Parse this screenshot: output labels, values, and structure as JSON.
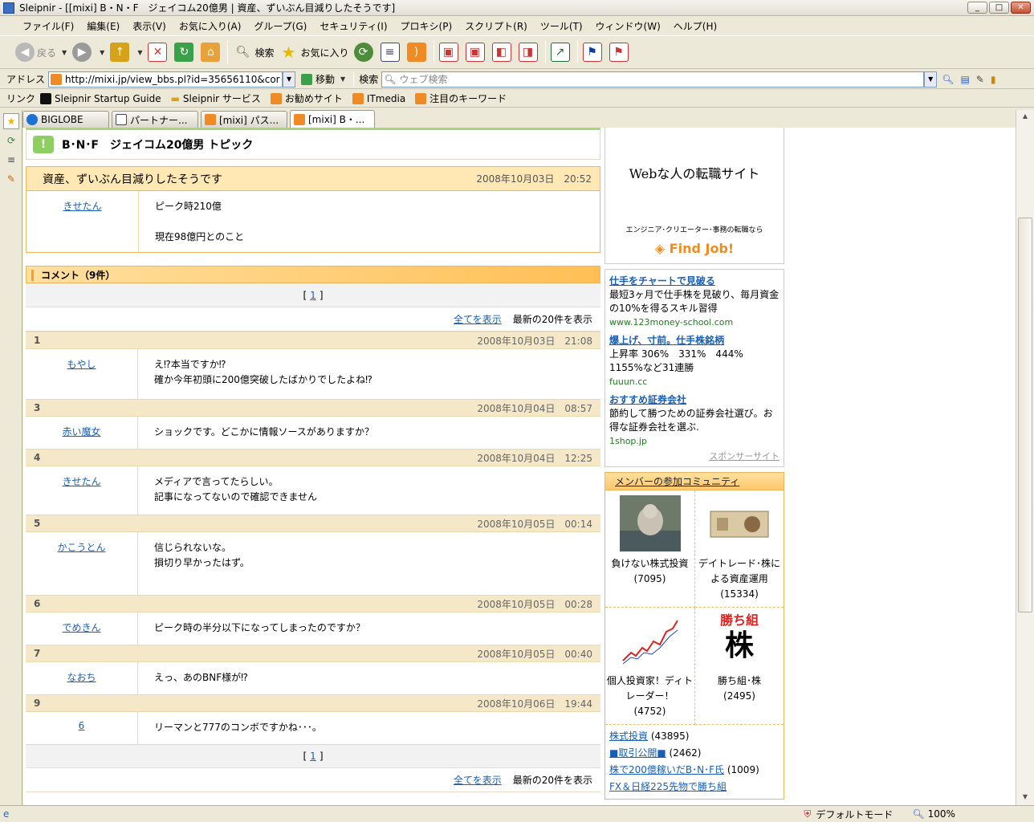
{
  "window": {
    "title": "Sleipnir - [[mixi] B・N・F　ジェイコム20億男 | 資産、ずいぶん目減りしたそうです]"
  },
  "menu": [
    "ファイル(F)",
    "編集(E)",
    "表示(V)",
    "お気に入り(A)",
    "グループ(G)",
    "セキュリティ(I)",
    "プロキシ(P)",
    "スクリプト(R)",
    "ツール(T)",
    "ウィンドウ(W)",
    "ヘルプ(H)"
  ],
  "toolbar": {
    "back": "戻る",
    "search": "検索",
    "favorites": "お気に入り"
  },
  "address": {
    "label": "アドレス",
    "url": "http://mixi.jp/view_bbs.pl?id=35656110&cor",
    "go": "移動",
    "search_label": "検索",
    "search_placeholder": "ウェブ検索"
  },
  "links": {
    "label": "リンク",
    "items": [
      "Sleipnir Startup Guide",
      "Sleipnir サービス",
      "お勧めサイト",
      "ITmedia",
      "注目のキーワード"
    ]
  },
  "tabs": [
    "BIGLOBE",
    "パートナー...",
    "[mixi] パス...",
    "[mixi] B・..."
  ],
  "topic": {
    "title": "B･N･F　ジェイコム20億男 トピック"
  },
  "post": {
    "title": "資産、ずいぶん目減りしたそうです",
    "date": "2008年10月03日　20:52",
    "author": "きせたん",
    "line1": "ピーク時210億",
    "line2": "現在98億円とのこと"
  },
  "comments_header": "コメント（9件）",
  "pager": {
    "page": "1",
    "show_all": "全てを表示",
    "latest": "最新の20件を表示"
  },
  "comments": [
    {
      "num": "1",
      "date": "2008年10月03日　21:08",
      "author": "もやし",
      "lines": [
        "え⁉本当ですか⁉",
        "確か今年初頭に200億突破したばかりでしたよね⁉"
      ]
    },
    {
      "num": "3",
      "date": "2008年10月04日　08:57",
      "author": "赤い魔女",
      "lines": [
        "ショックです。どこかに情報ソースがありますか？"
      ]
    },
    {
      "num": "4",
      "date": "2008年10月04日　12:25",
      "author": "きせたん",
      "lines": [
        "メディアで言ってたらしい。",
        "記事になってないので確認できません"
      ]
    },
    {
      "num": "5",
      "date": "2008年10月05日　00:14",
      "author": "かこうとん",
      "lines": [
        "信じられないな。",
        "損切り早かったはず。"
      ]
    },
    {
      "num": "6",
      "date": "2008年10月05日　00:28",
      "author": "でめきん",
      "lines": [
        "ピーク時の半分以下になってしまったのですか？"
      ]
    },
    {
      "num": "7",
      "date": "2008年10月05日　00:40",
      "author": "なおち",
      "lines": [
        "えっ、あのBNF様が⁉"
      ]
    },
    {
      "num": "9",
      "date": "2008年10月06日　19:44",
      "author": "6",
      "lines": [
        "リーマンと777のコンボですかね･･･。"
      ]
    }
  ],
  "ad_top": {
    "headline": "Webな人の転職サイト",
    "sub": "エンジニア･クリエーター･事務の転職なら",
    "brand": "Find Job!"
  },
  "sponsored": [
    {
      "title": "仕手をチャートで見破る",
      "desc": "最短3ヶ月で仕手株を見破り、毎月資金の10%を得るスキル習得",
      "url": "www.123money-school.com"
    },
    {
      "title": "爆上げ、寸前。仕手株銘柄",
      "desc": "上昇率 306%　331%　444%　1155%など31連勝",
      "url": "fuuun.cc"
    },
    {
      "title": "おすすめ証券会社",
      "desc": "節約して勝つための証券会社選び。お得な証券会社を選ぶ.",
      "url": "1shop.jp"
    }
  ],
  "sponsor_footer": "スポンサーサイト",
  "community": {
    "header": "メンバーの参加コミュニティ",
    "grid": [
      {
        "name": "負けない株式投資",
        "count": "(7095)"
      },
      {
        "name": "デイトレード･株による資産運用",
        "count": "(15334)"
      },
      {
        "name": "個人投資家！ディトレーダー！",
        "count": "(4752)"
      },
      {
        "name": "勝ち組･株",
        "count": "(2495)"
      }
    ],
    "grid_img_text": {
      "kachigumi": "勝ち組",
      "kabu": "株"
    },
    "list": [
      {
        "name": "株式投資",
        "count": "(43895)"
      },
      {
        "name": "■取引公開■",
        "count": "(2462)"
      },
      {
        "name": "株で200億稼いだB･N･F氏",
        "count": "(1009)"
      },
      {
        "name": "FX＆日経225先物で勝ち組",
        "count": ""
      }
    ]
  },
  "status": {
    "mode": "デフォルトモード",
    "zoom": "100%"
  },
  "colors": {
    "accent_orange": "#f0b45c",
    "link": "#1a5fb4",
    "mixi_green": "#8fcf61"
  }
}
